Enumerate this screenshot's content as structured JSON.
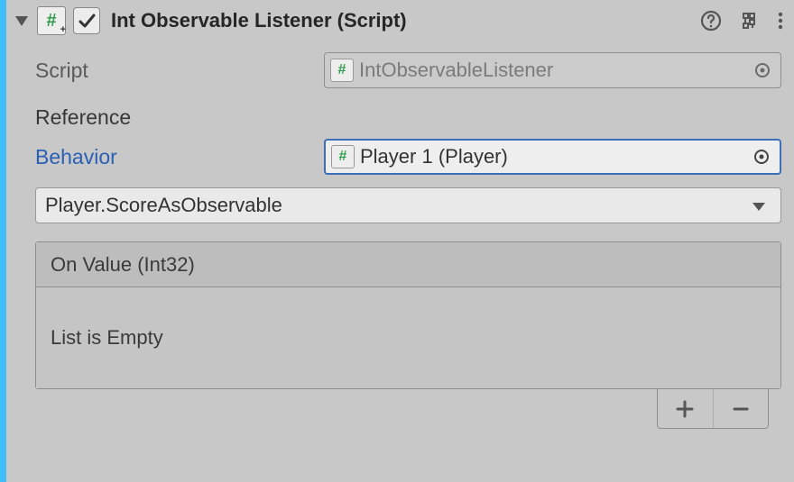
{
  "header": {
    "title": "Int Observable Listener (Script)"
  },
  "script": {
    "label": "Script",
    "value": "IntObservableListener"
  },
  "reference": {
    "label": "Reference"
  },
  "behavior": {
    "label": "Behavior",
    "value": "Player 1 (Player)"
  },
  "dropdown": {
    "value": "Player.ScoreAsObservable"
  },
  "event": {
    "header": "On Value (Int32)",
    "empty": "List is Empty"
  }
}
